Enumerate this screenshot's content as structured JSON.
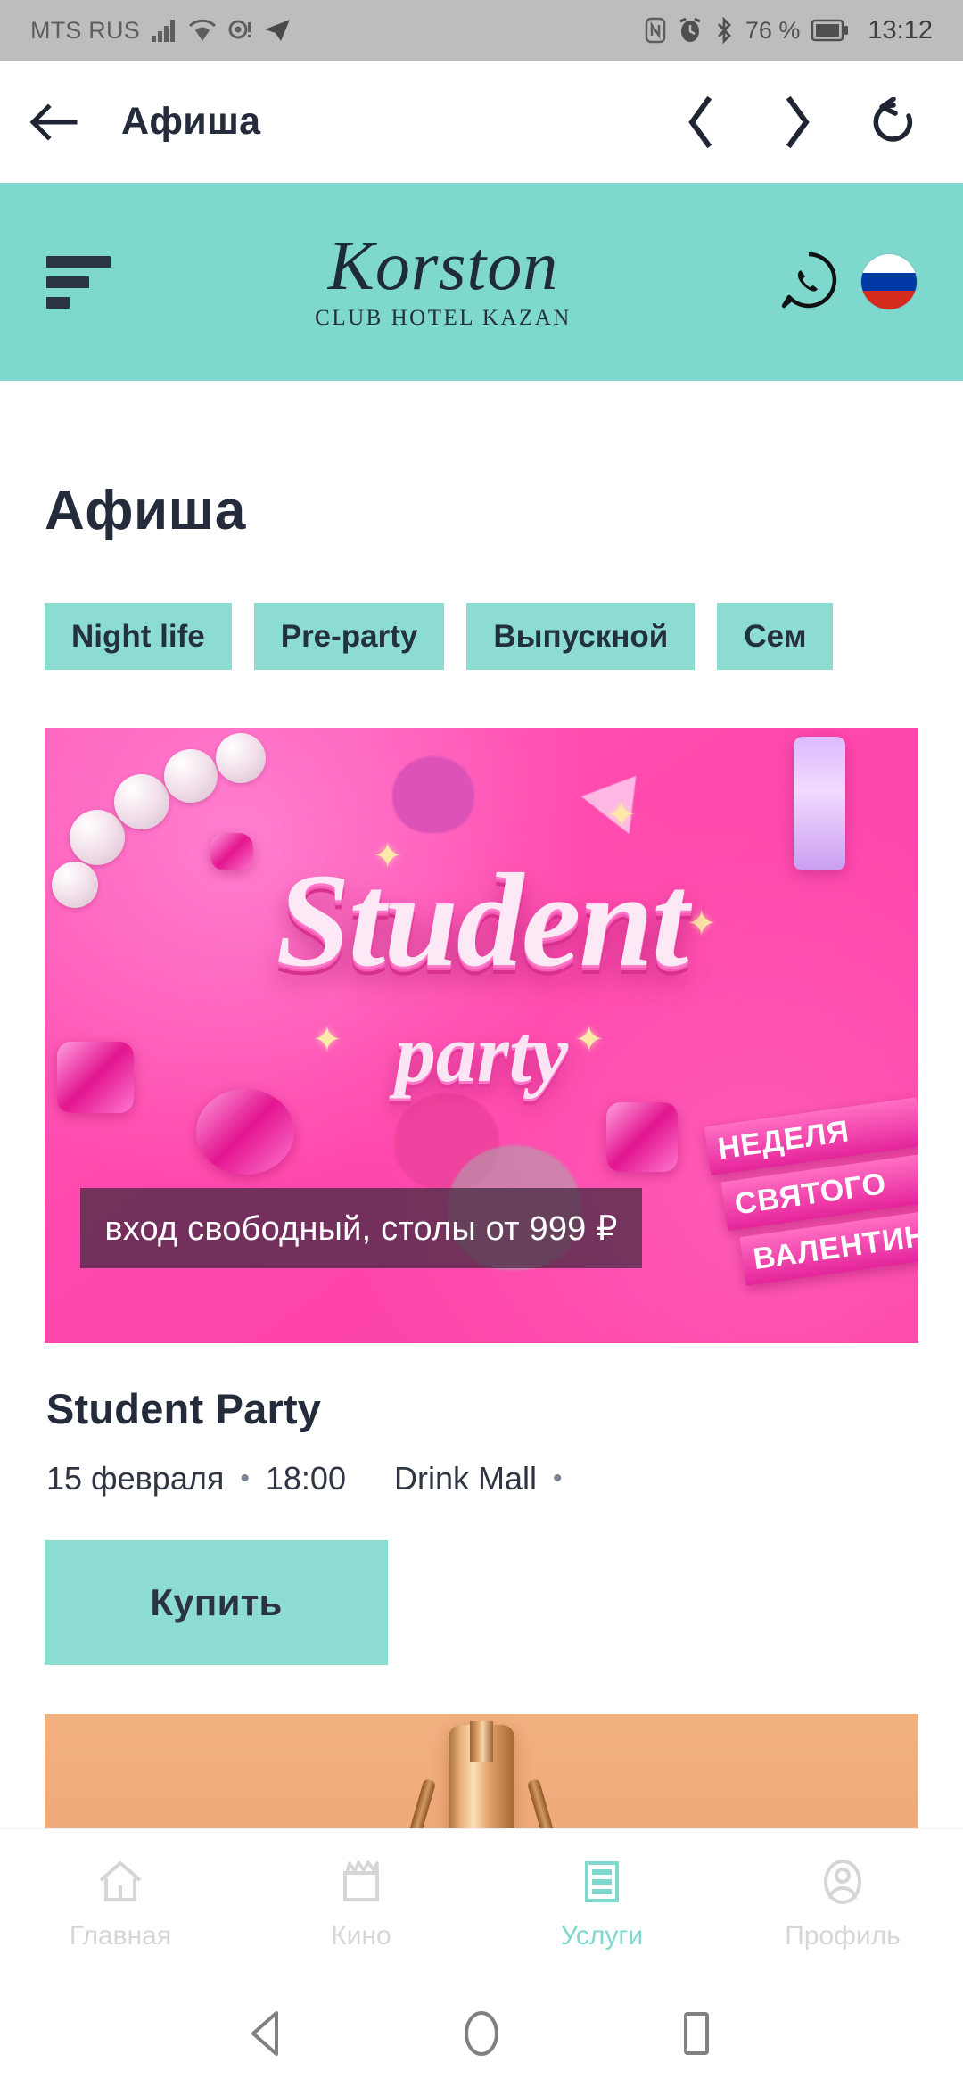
{
  "status_bar": {
    "carrier": "MTS RUS",
    "battery_percent": "76 %",
    "clock": "13:12",
    "icons": [
      "signal-icon",
      "wifi-icon",
      "location-icon",
      "telegram-icon",
      "nfc-icon",
      "alarm-icon",
      "bluetooth-icon",
      "battery-icon"
    ]
  },
  "toolbar": {
    "title": "Афиша",
    "back_icon": "arrow-left-icon",
    "prev_icon": "chevron-left-icon",
    "next_icon": "chevron-right-icon",
    "reload_icon": "reload-icon"
  },
  "site_header": {
    "menu_icon": "hamburger-icon",
    "brand_name": "Korston",
    "brand_subtitle": "CLUB HOTEL KAZAN",
    "whatsapp_icon": "whatsapp-icon",
    "language_icon": "russia-flag-icon",
    "background_color": "#7ed8ce"
  },
  "page": {
    "title": "Афиша",
    "chips": [
      {
        "label": "Night life"
      },
      {
        "label": "Pre-party"
      },
      {
        "label": "Выпускной"
      },
      {
        "label": "Сем"
      }
    ]
  },
  "event": {
    "poster_title": "Student",
    "poster_subtitle": "party",
    "ribbon": [
      "НЕДЕЛЯ",
      "СВЯТОГО",
      "ВАЛЕНТИНА"
    ],
    "caption": "вход свободный, столы от 999 ₽",
    "title": "Student Party",
    "date": "15 февраля",
    "time": "18:00",
    "venue": "Drink Mall",
    "separator": "•",
    "buy_label": "Купить"
  },
  "tabbar": {
    "items": [
      {
        "label": "Главная",
        "icon": "home-icon",
        "active": false
      },
      {
        "label": "Кино",
        "icon": "movie-clapper-icon",
        "active": false
      },
      {
        "label": "Услуги",
        "icon": "list-icon",
        "active": true
      },
      {
        "label": "Профиль",
        "icon": "person-icon",
        "active": false
      }
    ],
    "active_color": "#7ed8ce",
    "inactive_color": "#d6d6d6"
  },
  "android_nav": {
    "back_icon": "triangle-back-icon",
    "home_icon": "circle-home-icon",
    "recents_icon": "square-recents-icon"
  },
  "colors": {
    "teal": "#7ed8ce",
    "chip_teal": "#8ddcd2",
    "text_dark": "#242b3b"
  }
}
